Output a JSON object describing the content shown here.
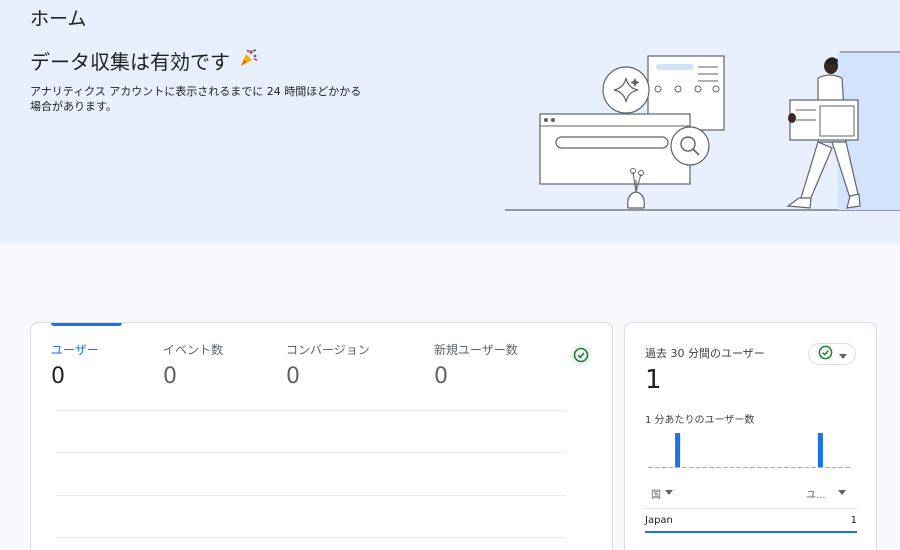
{
  "page": {
    "title": "ホーム"
  },
  "banner": {
    "heading": "データ収集は有効です",
    "heading_icon": "party-popper-icon",
    "description": "アナリティクス アカウントに表示されるまでに 24 時間ほどかかる場合があります。"
  },
  "overview": {
    "metrics": [
      {
        "label": "ユーザー",
        "value": "0",
        "active": true
      },
      {
        "label": "イベント数",
        "value": "0",
        "active": false
      },
      {
        "label": "コンバージョン",
        "value": "0",
        "active": false
      },
      {
        "label": "新規ユーザー数",
        "value": "0",
        "active": false
      }
    ],
    "status_icon": "check-circle-icon"
  },
  "realtime": {
    "title": "過去 30 分間のユーザー",
    "value": "1",
    "status_icon": "check-circle-icon",
    "chart_label": "1 分あたりのユーザー数",
    "chart_data": {
      "type": "bar",
      "xlabel": "",
      "ylabel": "",
      "values": [
        0,
        0,
        0,
        0,
        1,
        0,
        0,
        0,
        0,
        0,
        0,
        0,
        0,
        0,
        0,
        0,
        0,
        0,
        0,
        0,
        0,
        0,
        0,
        0,
        0,
        1,
        0,
        0,
        0,
        0
      ],
      "color": "#1a73e8"
    },
    "columns": {
      "dimension": "国",
      "metric": "ユ..."
    },
    "rows": [
      {
        "name": "Japan",
        "value": "1",
        "share": 1.0
      }
    ]
  },
  "colors": {
    "accent": "#1a73e8",
    "success": "#188038",
    "hero_bg": "#e8f0fe"
  }
}
